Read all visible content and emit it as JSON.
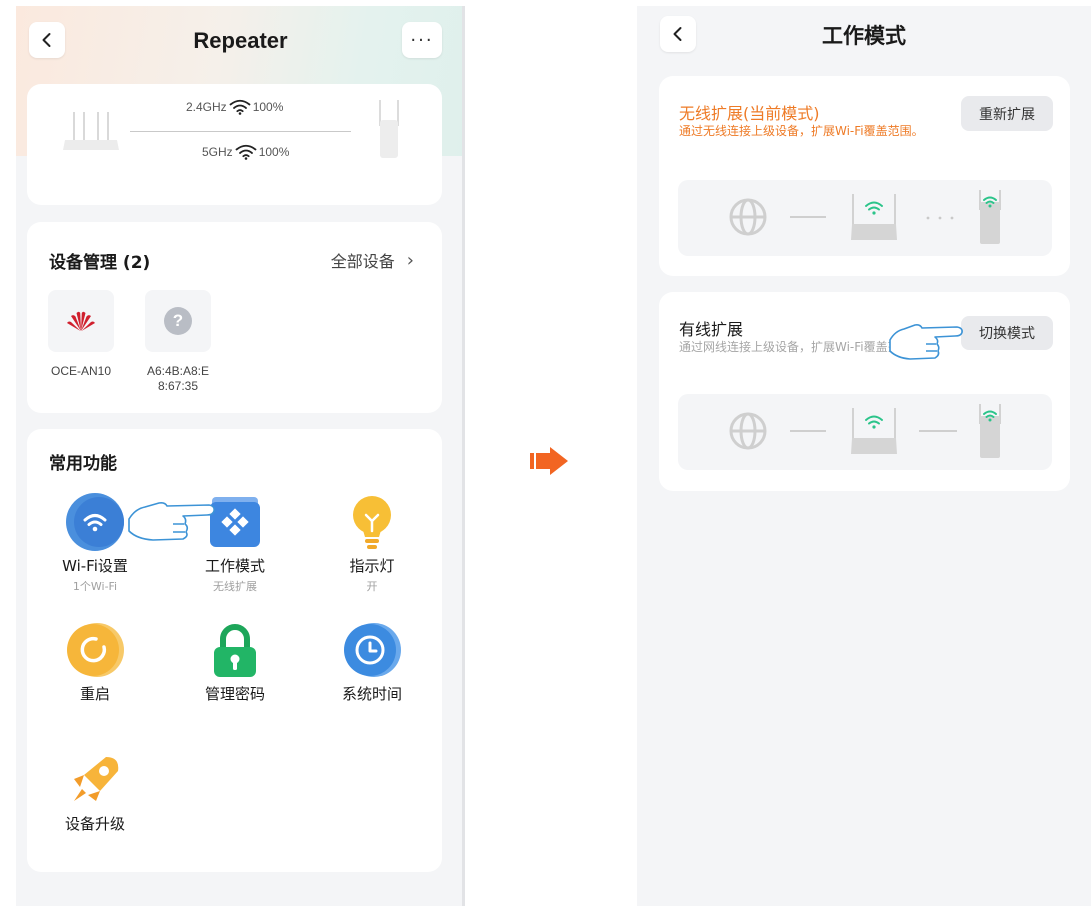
{
  "left": {
    "header": {
      "title": "Repeater",
      "more_label": "···"
    },
    "connection": {
      "band_24": "2.4GHz",
      "signal_24": "100%",
      "band_5": "5GHz",
      "signal_5": "100%"
    },
    "devices": {
      "title": "设备管理 (2)",
      "all_label": "全部设备",
      "items": [
        {
          "name": "OCE-AN10",
          "icon": "huawei-logo-icon"
        },
        {
          "name_line1": "A6:4B:A8:E",
          "name_line2": "8:67:35",
          "icon": "unknown-device-icon"
        }
      ]
    },
    "functions": {
      "title": "常用功能",
      "items": [
        {
          "label": "Wi-Fi设置",
          "sub": "1个Wi-Fi",
          "icon": "wifi-icon"
        },
        {
          "label": "工作模式",
          "sub": "无线扩展",
          "icon": "work-mode-icon"
        },
        {
          "label": "指示灯",
          "sub": "开",
          "icon": "bulb-icon"
        },
        {
          "label": "重启",
          "icon": "reboot-icon"
        },
        {
          "label": "管理密码",
          "icon": "lock-icon"
        },
        {
          "label": "系统时间",
          "icon": "clock-icon"
        },
        {
          "label": "设备升级",
          "icon": "rocket-icon"
        }
      ]
    }
  },
  "right": {
    "header": {
      "title": "工作模式"
    },
    "modes": [
      {
        "title": "无线扩展(当前模式)",
        "desc": "通过无线连接上级设备，扩展Wi-Fi覆盖范围。",
        "button": "重新扩展",
        "link": "wireless"
      },
      {
        "title": "有线扩展",
        "desc": "通过网线连接上级设备，扩展Wi-Fi覆盖范围。",
        "button": "切换模式",
        "link": "wired"
      }
    ]
  },
  "colors": {
    "accent_orange": "#ee7b27",
    "wifi_green": "#2bc48a",
    "hand_outline": "#3c93d6"
  }
}
